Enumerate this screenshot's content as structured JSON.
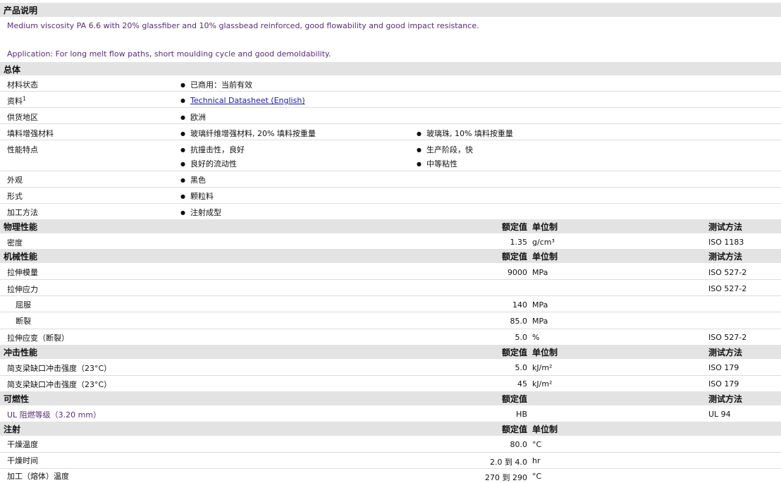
{
  "product_description": {
    "heading": "产品说明",
    "line1": "Medium viscosity PA 6.6 with 20% glassfiber and 10% glassbead reinforced, good flowability and good impact resistance.",
    "line2": "Application: For long melt flow paths, short moulding cycle and good demoldability."
  },
  "general": {
    "heading": "总体",
    "rows": [
      {
        "label": "材料状态",
        "col1": [
          "已商用：当前有效"
        ],
        "col2": []
      },
      {
        "label": "资料",
        "sup": "1",
        "col1": [
          "Technical Datasheet (English)"
        ],
        "col2": []
      },
      {
        "label": "供货地区",
        "col1": [
          "欧洲"
        ],
        "col2": []
      },
      {
        "label": "填料增强材料",
        "col1": [
          "玻璃纤维增强材料, 20% 填料按重量"
        ],
        "col2": [
          "玻璃珠, 10% 填料按重量"
        ]
      },
      {
        "label": "性能特点",
        "col1": [
          "抗撞击性，良好",
          "良好的流动性"
        ],
        "col2": [
          "生产阶段，快",
          "中等粘性"
        ]
      },
      {
        "label": "外观",
        "col1": [
          "黑色"
        ],
        "col2": []
      },
      {
        "label": "形式",
        "col1": [
          "颗粒料"
        ],
        "col2": []
      },
      {
        "label": "加工方法",
        "col1": [
          "注射成型"
        ],
        "col2": []
      }
    ]
  },
  "physical": {
    "heading": "物理性能",
    "h_value": "额定值",
    "h_unit": "单位制",
    "h_method": "测试方法",
    "rows": [
      {
        "label": "密度",
        "value": "1.35",
        "unit": "g/cm³",
        "method": "ISO 1183"
      }
    ]
  },
  "mechanical": {
    "heading": "机械性能",
    "h_value": "额定值",
    "h_unit": "单位制",
    "h_method": "测试方法",
    "rows": [
      {
        "label": "拉伸模量",
        "value": "9000",
        "unit": "MPa",
        "method": "ISO 527-2"
      },
      {
        "label": "拉伸应力",
        "value": "",
        "unit": "",
        "method": "ISO 527-2"
      },
      {
        "label": "屈服",
        "value": "140",
        "unit": "MPa",
        "method": "",
        "sub": true
      },
      {
        "label": "断裂",
        "value": "85.0",
        "unit": "MPa",
        "method": "",
        "sub": true
      },
      {
        "label": "拉伸应变（断裂）",
        "value": "5.0",
        "unit": "%",
        "method": "ISO 527-2"
      }
    ]
  },
  "impact": {
    "heading": "冲击性能",
    "h_value": "额定值",
    "h_unit": "单位制",
    "h_method": "测试方法",
    "rows": [
      {
        "label": "简支梁缺口冲击强度（23°C）",
        "value": "5.0",
        "unit": "kJ/m²",
        "method": "ISO 179"
      },
      {
        "label": "简支梁缺口冲击强度（23°C）",
        "value": "45",
        "unit": "kJ/m²",
        "method": "ISO 179"
      }
    ]
  },
  "flammability": {
    "heading": "可燃性",
    "h_value": "额定值",
    "h_method": "测试方法",
    "rows": [
      {
        "label": "UL 阻燃等级（3.20 mm）",
        "value": "HB",
        "unit": "",
        "method": "UL 94"
      }
    ]
  },
  "injection": {
    "heading": "注射",
    "h_value": "额定值",
    "h_unit": "单位制",
    "rows": [
      {
        "label": "干燥温度",
        "value": "80.0",
        "unit": "°C",
        "method": ""
      },
      {
        "label": "干燥时间",
        "value": "2.0 到  4.0",
        "unit": "hr",
        "method": ""
      },
      {
        "label": "加工（熔体）温度",
        "value": "270 到  290",
        "unit": "°C",
        "method": ""
      }
    ]
  }
}
